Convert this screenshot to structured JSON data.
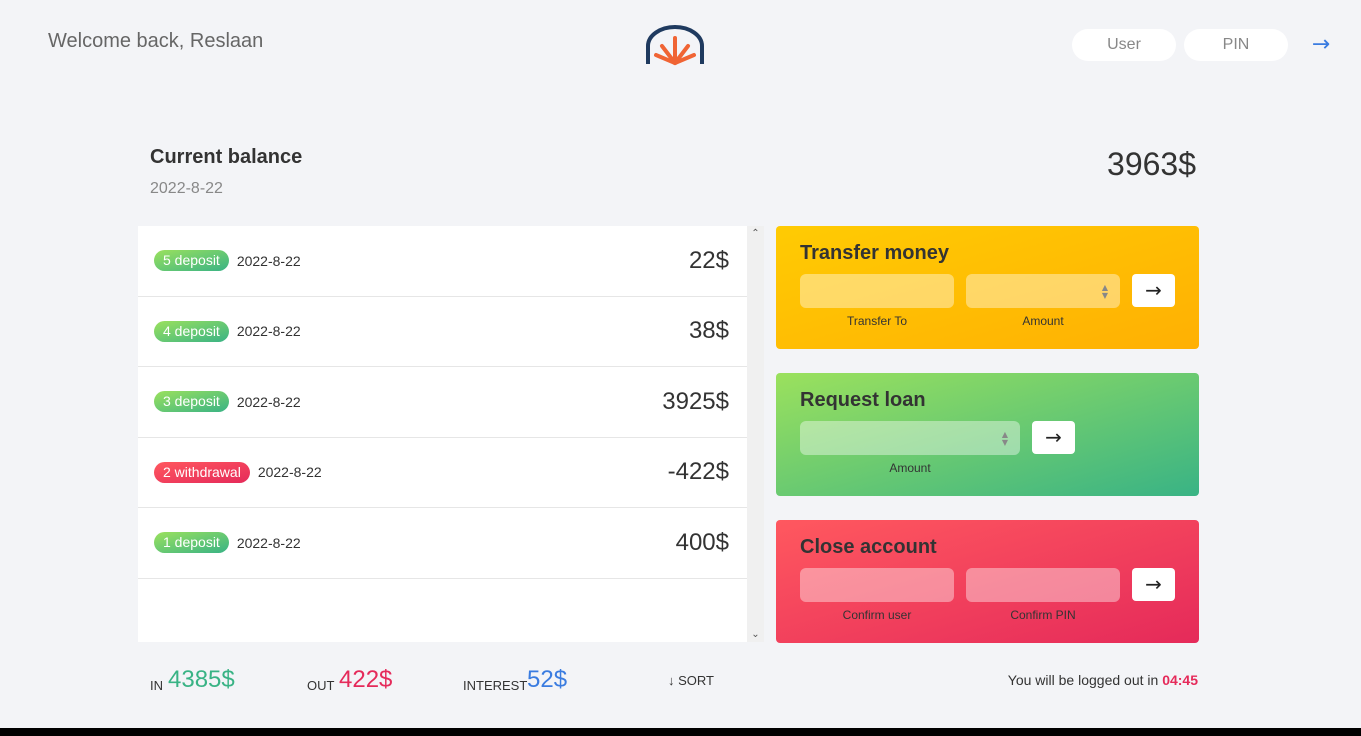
{
  "nav": {
    "welcome": "Welcome back, Reslaan",
    "user_placeholder": "User",
    "pin_placeholder": "PIN",
    "login_icon": "arrow-right-icon"
  },
  "balance": {
    "label": "Current balance",
    "date": "2022-8-22",
    "value": "3963$"
  },
  "movements": [
    {
      "type_label": "5 deposit",
      "kind": "deposit",
      "date": "2022-8-22",
      "value": "22$"
    },
    {
      "type_label": "4 deposit",
      "kind": "deposit",
      "date": "2022-8-22",
      "value": "38$"
    },
    {
      "type_label": "3 deposit",
      "kind": "deposit",
      "date": "2022-8-22",
      "value": "3925$"
    },
    {
      "type_label": "2 withdrawal",
      "kind": "withdrawal",
      "date": "2022-8-22",
      "value": "-422$"
    },
    {
      "type_label": "1 deposit",
      "kind": "deposit",
      "date": "2022-8-22",
      "value": "400$"
    }
  ],
  "operations": {
    "transfer": {
      "title": "Transfer money",
      "label_to": "Transfer To",
      "label_amount": "Amount",
      "button": "→"
    },
    "loan": {
      "title": "Request loan",
      "label_amount": "Amount",
      "button": "→"
    },
    "close": {
      "title": "Close account",
      "label_user": "Confirm user",
      "label_pin": "Confirm PIN",
      "button": "→"
    }
  },
  "summary": {
    "in_label": "In",
    "in_value": "4385$",
    "out_label": "Out",
    "out_value": "422$",
    "interest_label": "Interest",
    "interest_value": "52$",
    "sort_label": "↓ SORT"
  },
  "logout": {
    "text": "You will be logged out in ",
    "timer": "04:45"
  },
  "colors": {
    "deposit": "#39b385",
    "withdrawal": "#e52a5a",
    "interest": "#3a7ce0",
    "transfer_bg": "#ffb003",
    "background": "#f3f4f7"
  }
}
